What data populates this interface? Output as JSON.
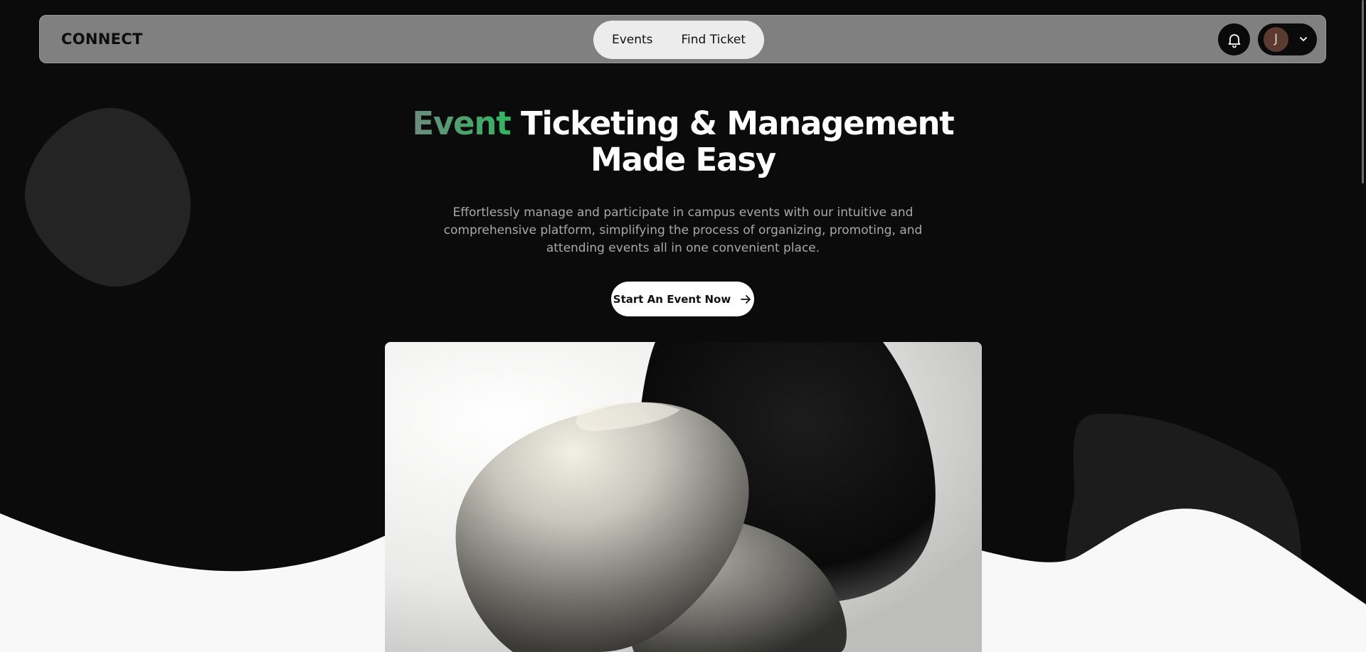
{
  "navbar": {
    "logo": "CONNECT",
    "links": [
      {
        "label": "Events"
      },
      {
        "label": "Find Ticket"
      }
    ],
    "notifications_icon": "bell-icon",
    "profile": {
      "avatar_initial": "J",
      "dropdown_icon": "chevron-down-icon"
    }
  },
  "hero": {
    "title_accent": "Event",
    "title_rest": " Ticketing & Management Made Easy",
    "subtitle": "Effortlessly manage and participate in campus events with our intuitive and comprehensive platform, simplifying the process of organizing, promoting, and attending events all in one convenient place.",
    "cta_label": "Start An Event Now",
    "cta_icon": "arrow-right-icon"
  },
  "colors": {
    "background": "#0b0b0b",
    "navbar": "#808080",
    "accent_start": "#6d8a80",
    "accent_end": "#2fb75f",
    "wave": "#f8f8f8",
    "blob": "#242424"
  }
}
